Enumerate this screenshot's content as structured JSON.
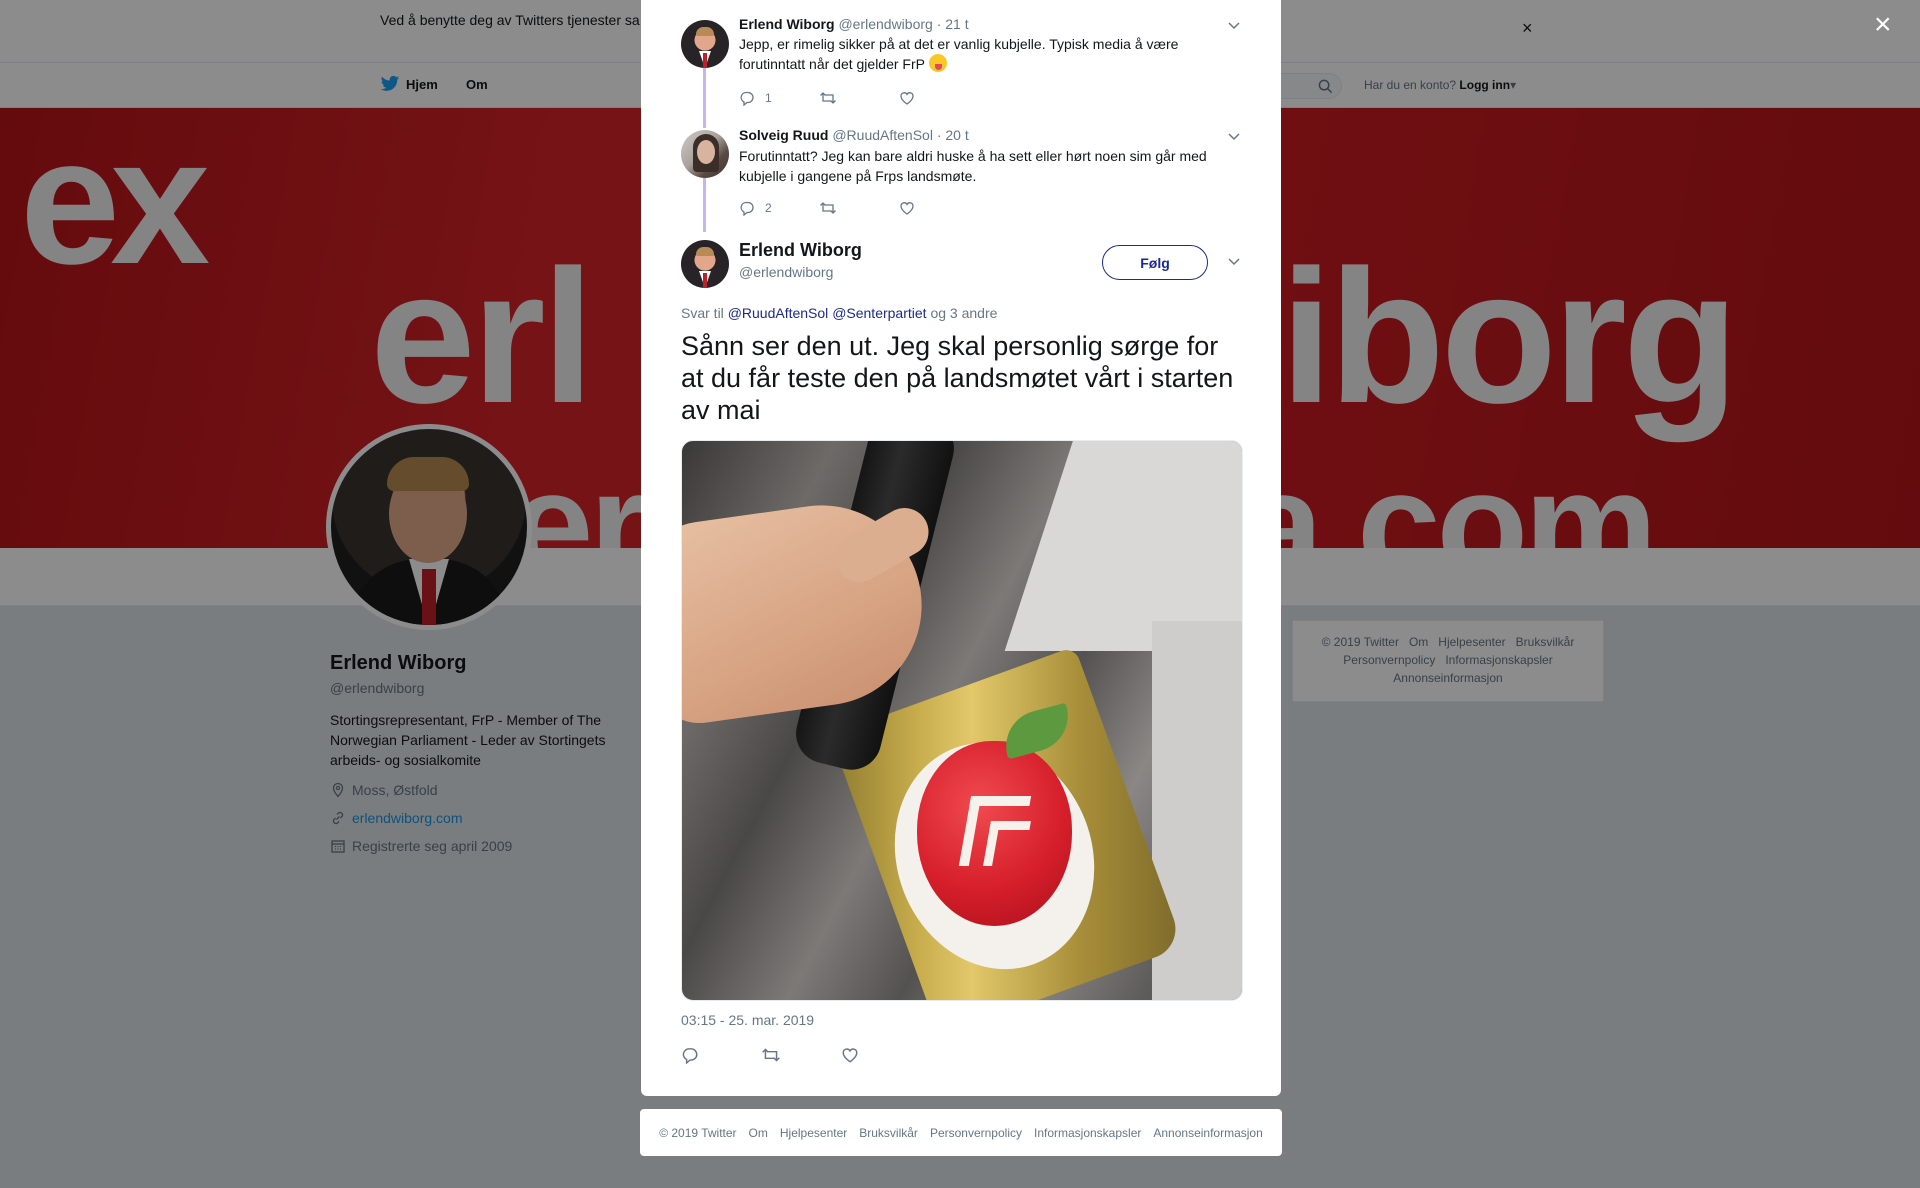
{
  "cookie": {
    "text": "Ved å benytte deg av Twitters tjenester sa… informasjonskapsler til bl.a. analyser, personalisering og annonser.",
    "close": "×"
  },
  "nav": {
    "home": "Hjem",
    "about": "Om",
    "login_prompt": "Har du en konto?",
    "login": "Logg inn"
  },
  "profile": {
    "name": "Erlend Wiborg",
    "handle": "@erlendwiborg",
    "bio": "Stortingsrepresentant, FrP - Member of The Norwegian Parliament - Leder av Stortingets arbeids- og sosialkomite",
    "location": "Moss, Østfold",
    "website": "erlendwiborg.com",
    "joined": "Registrerte seg april 2009"
  },
  "side_footer": {
    "items": [
      "© 2019 Twitter",
      "Om",
      "Hjelpesenter",
      "Bruksvilkår",
      "Personvernpolicy",
      "Informasjonskapsler",
      "Annonseinformasjon"
    ]
  },
  "overlay": {
    "close": "×"
  },
  "thread": [
    {
      "name": "Erlend Wiborg",
      "handle": "@erlendwiborg",
      "time": "· 21 t",
      "text": "Jepp, er rimelig sikker på at det er vanlig kubjelle. Typisk media å være forutinntatt når det gjelder FrP",
      "replies": "1",
      "retweets": "",
      "likes": ""
    },
    {
      "name": "Solveig Ruud",
      "handle": "@RuudAftenSol",
      "time": "· 20 t",
      "text": "Forutinntatt? Jeg kan bare aldri huske å ha sett eller hørt noen sim går med kubjelle i gangene på Frps landsmøte.",
      "replies": "2",
      "retweets": "",
      "likes": ""
    }
  ],
  "main_tweet": {
    "name": "Erlend Wiborg",
    "handle": "@erlendwiborg",
    "follow": "Følg",
    "reply_prefix": "Svar til",
    "mention1": "@RuudAftenSol",
    "mention2": "@Senterpartiet",
    "reply_suffix": "og 3 andre",
    "text": "Sånn ser den ut. Jeg skal personlig sørge for at du får teste den på landsmøtet vårt i starten av mai",
    "timestamp": "03:15 - 25. mar. 2019"
  },
  "modal_footer": {
    "items": [
      "© 2019 Twitter",
      "Om",
      "Hjelpesenter",
      "Bruksvilkår",
      "Personvernpolicy",
      "Informasjonskapsler",
      "Annonseinformasjon"
    ]
  },
  "colors": {
    "accent": "#1b2a8f",
    "banner": "#cf1d23",
    "thread_line": "#c4b7f0"
  }
}
